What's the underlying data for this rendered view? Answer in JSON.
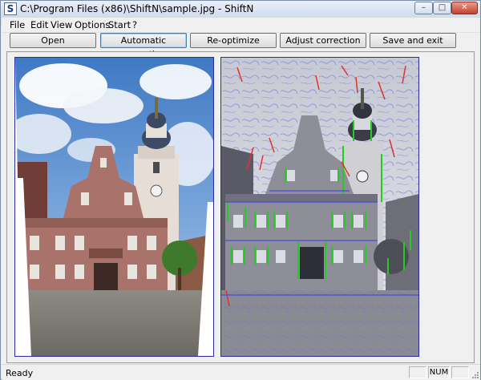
{
  "window": {
    "title": "C:\\Program Files (x86)\\ShiftN\\sample.jpg - ShiftN",
    "icon_letter": "S",
    "icon": "shiftn-app-icon",
    "controls": {
      "minimize_icon": "minimize-icon",
      "maximize_icon": "maximize-icon",
      "close_icon": "close-icon"
    }
  },
  "menu": {
    "items": [
      "File",
      "Edit",
      "View",
      "Options",
      "Start",
      "?"
    ]
  },
  "toolbar": {
    "buttons": [
      "Open",
      "Automatic correction",
      "Re-optimize",
      "Adjust correction",
      "Save and exit"
    ],
    "active": "Automatic correction"
  },
  "panels": {
    "left": "corrected-image-preview",
    "right": "line-detection-overlay-preview"
  },
  "colors": {
    "panel_border": "#2b2ba8",
    "sky": "#5b8fcf",
    "facade": "#a9736b",
    "overlay_vertical": "#22cc22",
    "overlay_red": "#e03030",
    "overlay_blue": "#5a5ae0"
  },
  "status": {
    "text": "Ready",
    "indicator": "NUM"
  }
}
